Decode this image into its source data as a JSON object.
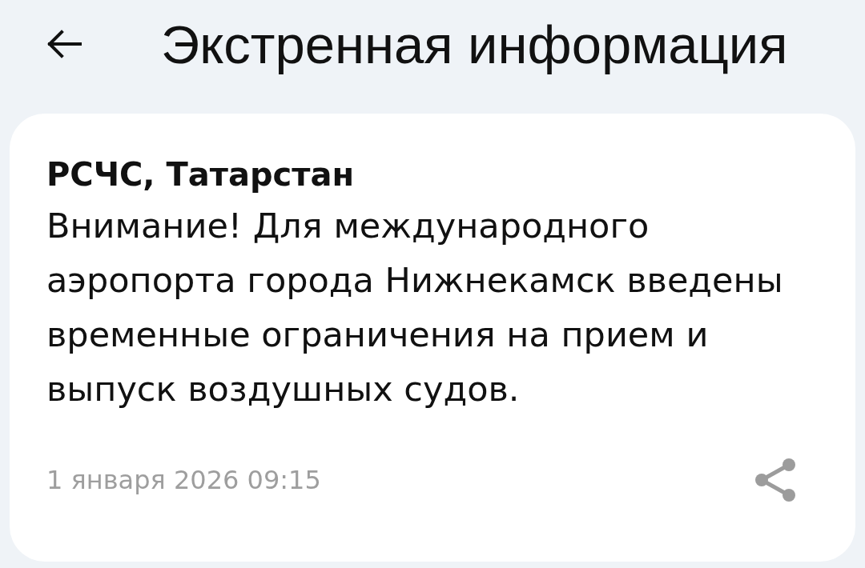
{
  "header": {
    "title": "Экстренная информация"
  },
  "alert": {
    "source": "РСЧС, Татарстан",
    "message": "Внимание! Для международного аэропорта города Нижнекамск введены временные ограничения на прием и выпуск воздушных судов.",
    "timestamp": "1 января 2026 09:15"
  }
}
